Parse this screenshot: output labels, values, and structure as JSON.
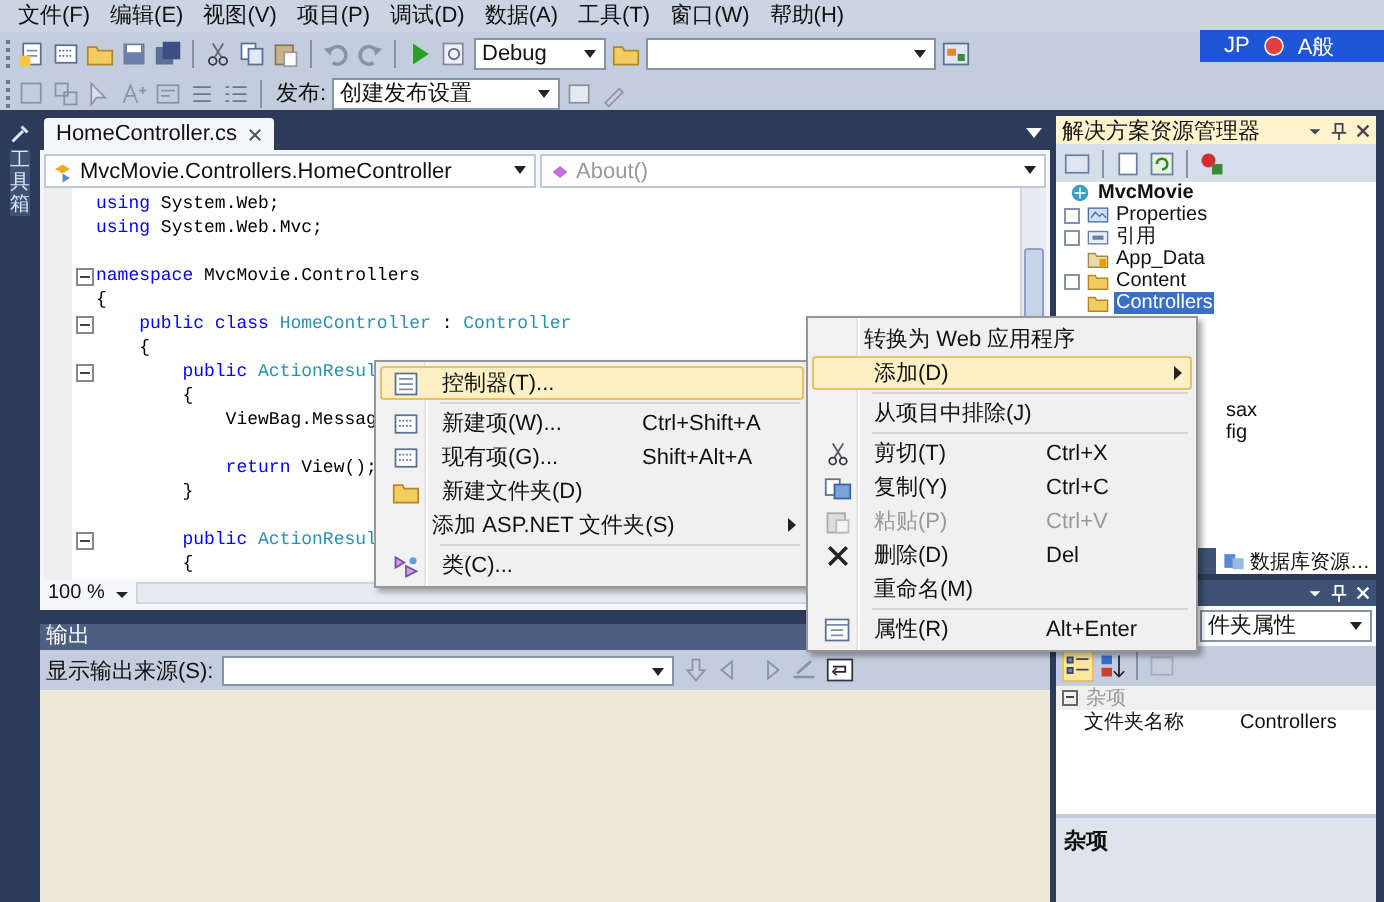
{
  "menu_bar": [
    "文件(F)",
    "编辑(E)",
    "视图(V)",
    "项目(P)",
    "调试(D)",
    "数据(A)",
    "工具(T)",
    "窗口(W)",
    "帮助(H)"
  ],
  "toolbar": {
    "configuration": "Debug",
    "publish_label": "发布:",
    "publish_profile": "创建发布设置"
  },
  "language_bar": {
    "language": "JP",
    "input_mode": "A般"
  },
  "toolbox": {
    "label": "工具箱"
  },
  "editor": {
    "tab": "HomeController.cs",
    "type_dropdown": "MvcMovie.Controllers.HomeController",
    "member_dropdown": "About()",
    "zoom": "100 %",
    "code_lines": [
      {
        "fold": false,
        "tokens": [
          {
            "kind": "keyword",
            "text": "using"
          },
          {
            "kind": "plain",
            "text": " System.Web;"
          }
        ]
      },
      {
        "fold": false,
        "tokens": [
          {
            "kind": "keyword",
            "text": "using"
          },
          {
            "kind": "plain",
            "text": " System.Web.Mvc;"
          }
        ]
      },
      {
        "fold": false
      },
      {
        "fold": true,
        "tokens": [
          {
            "kind": "keyword",
            "text": "namespace"
          },
          {
            "kind": "plain",
            "text": " MvcMovie.Controllers"
          }
        ]
      },
      {
        "fold": false,
        "tokens": [
          {
            "kind": "plain",
            "text": "{"
          }
        ]
      },
      {
        "fold": true,
        "tokens": [
          {
            "kind": "keyword",
            "text": "    public class"
          },
          {
            "kind": "type",
            "text": " HomeController"
          },
          {
            "kind": "plain",
            "text": " : "
          },
          {
            "kind": "type",
            "text": "Controller"
          }
        ]
      },
      {
        "fold": false,
        "tokens": [
          {
            "kind": "plain",
            "text": "    {"
          }
        ]
      },
      {
        "fold": true,
        "tokens": [
          {
            "kind": "keyword",
            "text": "        public"
          },
          {
            "kind": "type",
            "text": " ActionResul"
          }
        ]
      },
      {
        "fold": false,
        "tokens": [
          {
            "kind": "plain",
            "text": "        {"
          }
        ]
      },
      {
        "fold": false,
        "tokens": [
          {
            "kind": "plain",
            "text": "            ViewBag.Messag"
          }
        ]
      },
      {
        "fold": false
      },
      {
        "fold": false,
        "tokens": [
          {
            "kind": "keyword",
            "text": "            return"
          },
          {
            "kind": "plain",
            "text": " View();"
          }
        ]
      },
      {
        "fold": false,
        "tokens": [
          {
            "kind": "plain",
            "text": "        }"
          }
        ]
      },
      {
        "fold": false
      },
      {
        "fold": true,
        "tokens": [
          {
            "kind": "keyword",
            "text": "        public"
          },
          {
            "kind": "type",
            "text": " ActionResul"
          }
        ]
      },
      {
        "fold": false,
        "tokens": [
          {
            "kind": "plain",
            "text": "        {"
          }
        ]
      }
    ]
  },
  "output": {
    "title": "输出",
    "source_label": "显示输出来源(S):"
  },
  "solution_explorer": {
    "title": "解决方案资源管理器",
    "root": {
      "label": "MvcMovie",
      "children": [
        {
          "label": "Properties",
          "collapsed": true,
          "selected": false
        },
        {
          "label": "引用",
          "collapsed": true,
          "selected": false
        },
        {
          "label": "App_Data",
          "collapsed": false,
          "selected": false
        },
        {
          "label": "Content",
          "collapsed": true,
          "selected": false
        },
        {
          "label": "Controllers",
          "collapsed": false,
          "selected": true
        }
      ]
    },
    "partial_items": [
      "sax",
      "fig"
    ],
    "bottom_tab": "数据库资源…"
  },
  "properties": {
    "object_dropdown": "件夹属性",
    "category": "杂项",
    "rows": [
      {
        "name": "文件夹名称",
        "value": "Controllers"
      }
    ],
    "description_title": "杂项"
  },
  "context_menu": {
    "items": [
      {
        "label": "转换为 Web 应用程序",
        "selected": false,
        "disabled": false,
        "submenu": false,
        "separator_before": false
      },
      {
        "label": "添加(D)",
        "selected": true,
        "disabled": false,
        "submenu": true,
        "separator_before": false
      },
      {
        "label": "从项目中排除(J)",
        "selected": false,
        "disabled": false,
        "submenu": false,
        "separator_before": true
      },
      {
        "label": "剪切(T)",
        "shortcut": "Ctrl+X",
        "selected": false,
        "disabled": false,
        "submenu": false,
        "separator_before": true
      },
      {
        "label": "复制(Y)",
        "shortcut": "Ctrl+C",
        "selected": false,
        "disabled": false,
        "submenu": false,
        "separator_before": false
      },
      {
        "label": "粘贴(P)",
        "shortcut": "Ctrl+V",
        "selected": false,
        "disabled": true,
        "submenu": false,
        "separator_before": false
      },
      {
        "label": "删除(D)",
        "shortcut": "Del",
        "selected": false,
        "disabled": false,
        "submenu": false,
        "separator_before": false
      },
      {
        "label": "重命名(M)",
        "selected": false,
        "disabled": false,
        "submenu": false,
        "separator_before": false
      },
      {
        "label": "属性(R)",
        "shortcut": "Alt+Enter",
        "selected": false,
        "disabled": false,
        "submenu": false,
        "separator_before": true
      }
    ]
  },
  "submenu": {
    "items": [
      {
        "label": "控制器(T)...",
        "selected": true,
        "submenu": false,
        "separator_before": false
      },
      {
        "label": "新建项(W)...",
        "shortcut": "Ctrl+Shift+A",
        "selected": false,
        "submenu": false,
        "separator_before": true
      },
      {
        "label": "现有项(G)...",
        "shortcut": "Shift+Alt+A",
        "selected": false,
        "submenu": false,
        "separator_before": false
      },
      {
        "label": "新建文件夹(D)",
        "selected": false,
        "submenu": false,
        "separator_before": false
      },
      {
        "label": "添加 ASP.NET 文件夹(S)",
        "selected": false,
        "submenu": true,
        "separator_before": false
      },
      {
        "label": "类(C)...",
        "selected": false,
        "submenu": false,
        "separator_before": true
      }
    ]
  }
}
